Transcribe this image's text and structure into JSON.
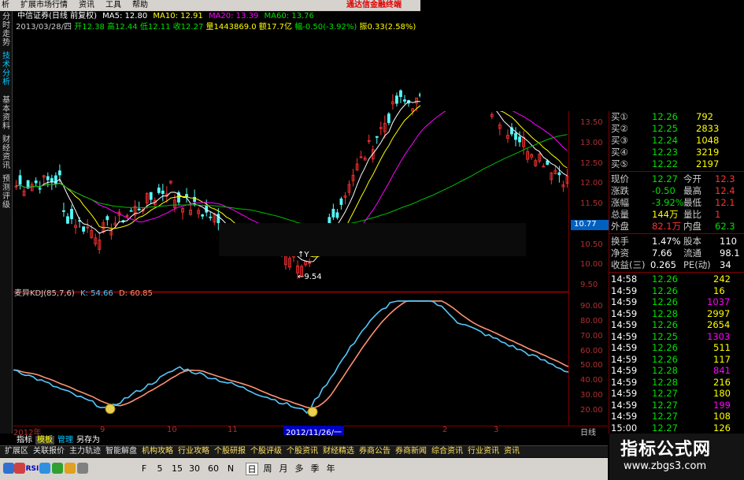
{
  "menu": {
    "items": [
      "析",
      "扩展市场行情",
      "资讯",
      "工具",
      "帮助"
    ],
    "brand": "通达信金融终端"
  },
  "left_tabs": [
    "分时走势",
    "技术分析",
    "基本资料",
    "财经资讯",
    "预测评级"
  ],
  "header": {
    "stock": "中信证券",
    "mode": "(日线 前复权)",
    "ma5": "MA5: 12.80",
    "ma10": "MA10: 12.91",
    "ma20": "MA20: 13.39",
    "ma60": "MA60: 13.76",
    "date": "2013/03/28/四",
    "open": "开12.38",
    "high": "高12.44",
    "low": "低12.11",
    "close": "收12.27",
    "volume": "量1443869.0",
    "amount": "额17.7亿",
    "change": "幅-0.50(-3.92%)",
    "amplitude": "振0.33(2.58%)"
  },
  "annotations": {
    "low_label": "9.54",
    "high_mark": "↑Y"
  },
  "kdj": {
    "title": "麦异KDJ(85,7,6)",
    "k": "K: 54.66",
    "d": "D: 60.85"
  },
  "price_axis": {
    "labels": [
      "13.50",
      "13.00",
      "12.50",
      "12.00",
      "11.50",
      "11.00",
      "10.50",
      "10.00",
      "9.50"
    ],
    "current": "10.77"
  },
  "kdj_axis": {
    "labels": [
      "90.00",
      "80.00",
      "70.00",
      "60.00",
      "50.00",
      "40.00",
      "30.00",
      "20.00"
    ]
  },
  "dates": {
    "labels": [
      "2012年",
      "9",
      "10",
      "11",
      "2",
      "3"
    ],
    "cursor": "2012/11/26/一",
    "end": "日线"
  },
  "quote": {
    "bids": [
      {
        "label": "买①",
        "price": "12.26",
        "vol": "792"
      },
      {
        "label": "买②",
        "price": "12.25",
        "vol": "2833"
      },
      {
        "label": "买③",
        "price": "12.24",
        "vol": "1048"
      },
      {
        "label": "买④",
        "price": "12.23",
        "vol": "3219"
      },
      {
        "label": "买⑤",
        "price": "12.22",
        "vol": "2197"
      }
    ],
    "stats": [
      {
        "l1": "现价",
        "v1": "12.27",
        "l2": "今开",
        "v2": "12.3"
      },
      {
        "l1": "涨跌",
        "v1": "-0.50",
        "l2": "最高",
        "v2": "12.4"
      },
      {
        "l1": "涨幅",
        "v1": "-3.92%",
        "l2": "最低",
        "v2": "12.1"
      },
      {
        "l1": "总量",
        "v1": "144万",
        "l2": "量比",
        "v2": "1"
      },
      {
        "l1": "外盘",
        "v1": "82.1万",
        "l2": "内盘",
        "v2": "62.3"
      }
    ],
    "stats2": [
      {
        "l1": "换手",
        "v1": "1.47%",
        "l2": "股本",
        "v2": "110"
      },
      {
        "l1": "净资",
        "v1": "7.66",
        "l2": "流通",
        "v2": "98.1"
      },
      {
        "l1": "收益(三)",
        "v1": "0.265",
        "l2": "PE(动)",
        "v2": "34"
      }
    ],
    "ticks": [
      {
        "t": "14:58",
        "p": "12.26",
        "v": "242"
      },
      {
        "t": "14:59",
        "p": "12.26",
        "v": "16"
      },
      {
        "t": "14:59",
        "p": "12.26",
        "v": "1037"
      },
      {
        "t": "14:59",
        "p": "12.28",
        "v": "2997"
      },
      {
        "t": "14:59",
        "p": "12.26",
        "v": "2654"
      },
      {
        "t": "14:59",
        "p": "12.25",
        "v": "1303"
      },
      {
        "t": "14:59",
        "p": "12.26",
        "v": "511"
      },
      {
        "t": "14:59",
        "p": "12.26",
        "v": "117"
      },
      {
        "t": "14:59",
        "p": "12.28",
        "v": "841"
      },
      {
        "t": "14:59",
        "p": "12.28",
        "v": "216"
      },
      {
        "t": "14:59",
        "p": "12.27",
        "v": "180"
      },
      {
        "t": "14:59",
        "p": "12.27",
        "v": "199"
      },
      {
        "t": "14:59",
        "p": "12.27",
        "v": "108"
      },
      {
        "t": "15:00",
        "p": "12.27",
        "v": "126"
      }
    ]
  },
  "indicator_tabs": [
    "指标",
    "模板",
    "管理",
    "另存为"
  ],
  "func_tabs": [
    "扩展区",
    "关联报价",
    "主力轨迹",
    "智能解盘",
    "机构攻略",
    "行业攻略",
    "个股研报",
    "个股评级",
    "个股资讯",
    "财经精选",
    "券商公告",
    "券商新闻",
    "综合资讯",
    "行业资讯",
    "资讯"
  ],
  "toolbar": {
    "buttons": [
      "RSI",
      "F",
      "5",
      "15",
      "30",
      "60",
      "N",
      "日",
      "周",
      "月",
      "多",
      "季",
      "年"
    ]
  },
  "watermark": {
    "cn": "指标公式网",
    "url": "www.zbgs3.com"
  },
  "colors": {
    "up": "#ff3232",
    "down": "#54fcfc",
    "ma5": "#ffffff",
    "ma10": "#ffff00",
    "ma20": "#ff00ff",
    "ma60": "#00c000",
    "k": "#54c8fc",
    "d": "#ff9070"
  },
  "chart_data": [
    {
      "type": "candlestick",
      "price_axis_ticks": [
        13.5,
        13.0,
        12.5,
        12.0,
        11.5,
        11.0,
        10.5,
        10.0,
        9.5
      ],
      "low_annotation": 9.54,
      "series": [
        {
          "name": "MA5"
        },
        {
          "name": "MA10"
        },
        {
          "name": "MA20"
        },
        {
          "name": "MA60"
        }
      ]
    },
    {
      "type": "line",
      "y_ticks": [
        90,
        80,
        70,
        60,
        50,
        40,
        30,
        20
      ],
      "k": 54.66,
      "d": 60.85
    }
  ]
}
